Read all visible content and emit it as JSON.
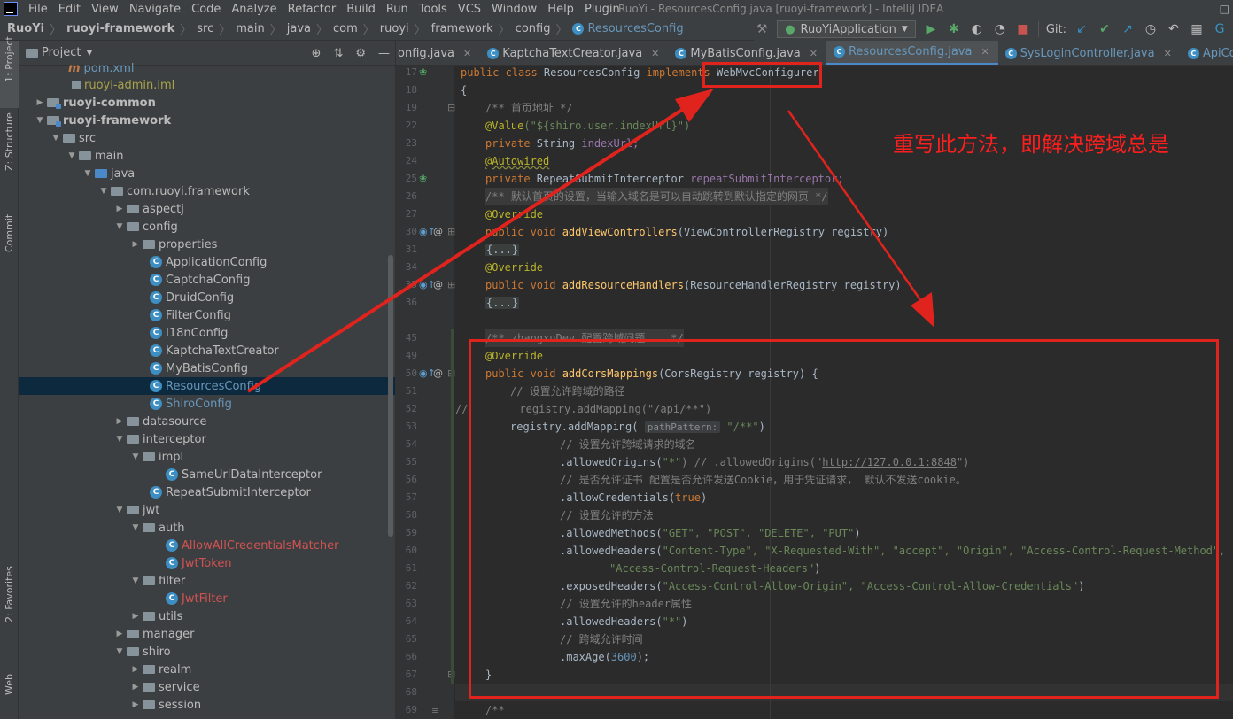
{
  "window": {
    "title": "RuoYi - ResourcesConfig.java [ruoyi-framework] - IntelliJ IDEA",
    "menu": [
      "File",
      "Edit",
      "View",
      "Navigate",
      "Code",
      "Analyze",
      "Refactor",
      "Build",
      "Run",
      "Tools",
      "VCS",
      "Window",
      "Help",
      "Plugin"
    ]
  },
  "breadcrumb": [
    "RuoYi",
    "ruoyi-framework",
    "src",
    "main",
    "java",
    "com",
    "ruoyi",
    "framework",
    "config",
    "ResourcesConfig"
  ],
  "toolbar": {
    "run_config": "RuoYiApplication",
    "git_label": "Git:"
  },
  "left_strip": {
    "project": "1: Project",
    "structure": "Z: Structure",
    "commit": "Commit",
    "favorites": "2: Favorites",
    "web": "Web"
  },
  "project_panel": {
    "title": "Project",
    "tree": [
      {
        "label": "pom.xml",
        "kind": "maven"
      },
      {
        "label": "ruoyi-admin.iml",
        "kind": "iml"
      },
      {
        "label": "ruoyi-common",
        "kind": "module-collapsed"
      },
      {
        "label": "ruoyi-framework",
        "kind": "module-expanded"
      },
      {
        "label": "src",
        "kind": "folder-open"
      },
      {
        "label": "main",
        "kind": "folder-open"
      },
      {
        "label": "java",
        "kind": "folder-open"
      },
      {
        "label": "com.ruoyi.framework",
        "kind": "folder-open"
      },
      {
        "label": "aspectj",
        "kind": "folder-closed"
      },
      {
        "label": "config",
        "kind": "folder-open"
      },
      {
        "label": "properties",
        "kind": "folder-closed"
      },
      {
        "label": "ApplicationConfig",
        "kind": "class"
      },
      {
        "label": "CaptchaConfig",
        "kind": "class"
      },
      {
        "label": "DruidConfig",
        "kind": "class"
      },
      {
        "label": "FilterConfig",
        "kind": "class"
      },
      {
        "label": "I18nConfig",
        "kind": "class"
      },
      {
        "label": "KaptchaTextCreator",
        "kind": "class"
      },
      {
        "label": "MyBatisConfig",
        "kind": "class"
      },
      {
        "label": "ResourcesConfig",
        "kind": "class",
        "selected": true
      },
      {
        "label": "ShiroConfig",
        "kind": "class"
      },
      {
        "label": "datasource",
        "kind": "folder-closed"
      },
      {
        "label": "interceptor",
        "kind": "folder-open"
      },
      {
        "label": "impl",
        "kind": "folder-open"
      },
      {
        "label": "SameUrlDataInterceptor",
        "kind": "class"
      },
      {
        "label": "RepeatSubmitInterceptor",
        "kind": "class"
      },
      {
        "label": "jwt",
        "kind": "folder-open"
      },
      {
        "label": "auth",
        "kind": "folder-open"
      },
      {
        "label": "AllowAllCredentialsMatcher",
        "kind": "class",
        "state": "error"
      },
      {
        "label": "JwtToken",
        "kind": "class",
        "state": "error"
      },
      {
        "label": "filter",
        "kind": "folder-open"
      },
      {
        "label": "JwtFilter",
        "kind": "class",
        "state": "error"
      },
      {
        "label": "utils",
        "kind": "folder-closed"
      },
      {
        "label": "manager",
        "kind": "folder-closed"
      },
      {
        "label": "shiro",
        "kind": "folder-open"
      },
      {
        "label": "realm",
        "kind": "folder-closed"
      },
      {
        "label": "service",
        "kind": "folder-closed"
      },
      {
        "label": "session",
        "kind": "folder-closed"
      }
    ]
  },
  "editor_tabs": [
    {
      "label": "onfig.java"
    },
    {
      "label": "KaptchaTextCreator.java"
    },
    {
      "label": "MyBatisConfig.java"
    },
    {
      "label": "ResourcesConfig.java",
      "active": true
    },
    {
      "label": "SysLoginController.java"
    },
    {
      "label": "ApiController.java"
    }
  ],
  "line_numbers": [
    "17",
    "18",
    "19",
    "22",
    "23",
    "24",
    "25",
    "26",
    "27",
    "30",
    "31",
    "34",
    "35",
    "36",
    "45",
    "49",
    "50",
    "51",
    "52",
    "53",
    "54",
    "55",
    "56",
    "57",
    "58",
    "59",
    "60",
    "61",
    "62",
    "63",
    "64",
    "65",
    "66",
    "67",
    "68",
    "69"
  ],
  "code": {
    "l17_a": "public class ",
    "l17_b": "ResourcesConfig ",
    "l17_c": "implements ",
    "l17_d": "WebMvcConfigurer",
    "l18": "{",
    "l19": "/** 首页地址 */",
    "l22_a": "@Value",
    "l22_b": "(\"${shiro.user.indexUrl}\")",
    "l23_a": "private ",
    "l23_b": "String ",
    "l23_c": "indexUrl;",
    "l24": "@Autowired",
    "l25_a": "private ",
    "l25_b": "RepeatSubmitInterceptor ",
    "l25_c": "repeatSubmitInterceptor;",
    "l26": "/** 默认首页的设置，当输入域名是可以自动跳转到默认指定的网页 */",
    "l27": "@Override",
    "l30_a": "public void ",
    "l30_b": "addViewControllers",
    "l30_c": "(ViewControllerRegistry registry)",
    "l31": "{...}",
    "l34": "@Override",
    "l35_a": "public void ",
    "l35_b": "addResourceHandlers",
    "l35_c": "(ResourceHandlerRegistry registry)",
    "l36": "{...}",
    "l45": "/** zhangxuDev 配置跨域问题    */",
    "l49": "@Override",
    "l50_a": "public void ",
    "l50_b": "addCorsMappings",
    "l50_c": "(CorsRegistry registry) {",
    "l51": "// 设置允许跨域的路径",
    "l52_a": "registry.addMapping(",
    "l52_b": "\"/api/**\"",
    "l52_c": ")",
    "l53_a": "registry.addMapping( ",
    "l53_hint": "pathPattern:",
    "l53_b": " \"/**\"",
    "l53_c": ")",
    "l54": "// 设置允许跨域请求的域名",
    "l55_a": ".allowedOrigins(",
    "l55_b": "\"*\"",
    "l55_c": ") // .allowedOrigins(\"",
    "l55_d": "http://127.0.0.1:8848",
    "l55_e": "\")",
    "l56": "// 是否允许证书 配置是否允许发送Cookie，用于凭证请求， 默认不发送cookie。",
    "l57_a": ".allowCredentials(",
    "l57_b": "true",
    "l57_c": ")",
    "l58": "// 设置允许的方法",
    "l59_a": ".allowedMethods(",
    "l59_b": "\"GET\", \"POST\", \"DELETE\", \"PUT\"",
    "l59_c": ")",
    "l60_a": ".allowedHeaders(",
    "l60_b": "\"Content-Type\", \"X-Requested-With\", \"accept\", \"Origin\", \"Access-Control-Request-Method\",",
    "l61_a": "\"Access-Control-Request-Headers\"",
    "l61_b": ")",
    "l62_a": ".exposedHeaders(",
    "l62_b": "\"Access-Control-Allow-Origin\", \"Access-Control-Allow-Credentials\"",
    "l62_c": ")",
    "l63": "// 设置允许的header属性",
    "l64_a": ".allowedHeaders(",
    "l64_b": "\"*\"",
    "l64_c": ")",
    "l65": "// 跨域允许时间",
    "l66_a": ".maxAge(",
    "l66_b": "3600",
    "l66_c": ");",
    "l67": "}",
    "l69": "/**"
  },
  "annotation": {
    "note": "重写此方法，即解决跨域总是",
    "color": "#ff1e1e"
  },
  "colors": {
    "keyword": "#cc7832",
    "annotation": "#bbb529",
    "string": "#6a8759",
    "number": "#6897bb",
    "comment": "#808080",
    "field": "#9876aa",
    "method": "#ffc66d",
    "highlight": "#e0241d"
  }
}
